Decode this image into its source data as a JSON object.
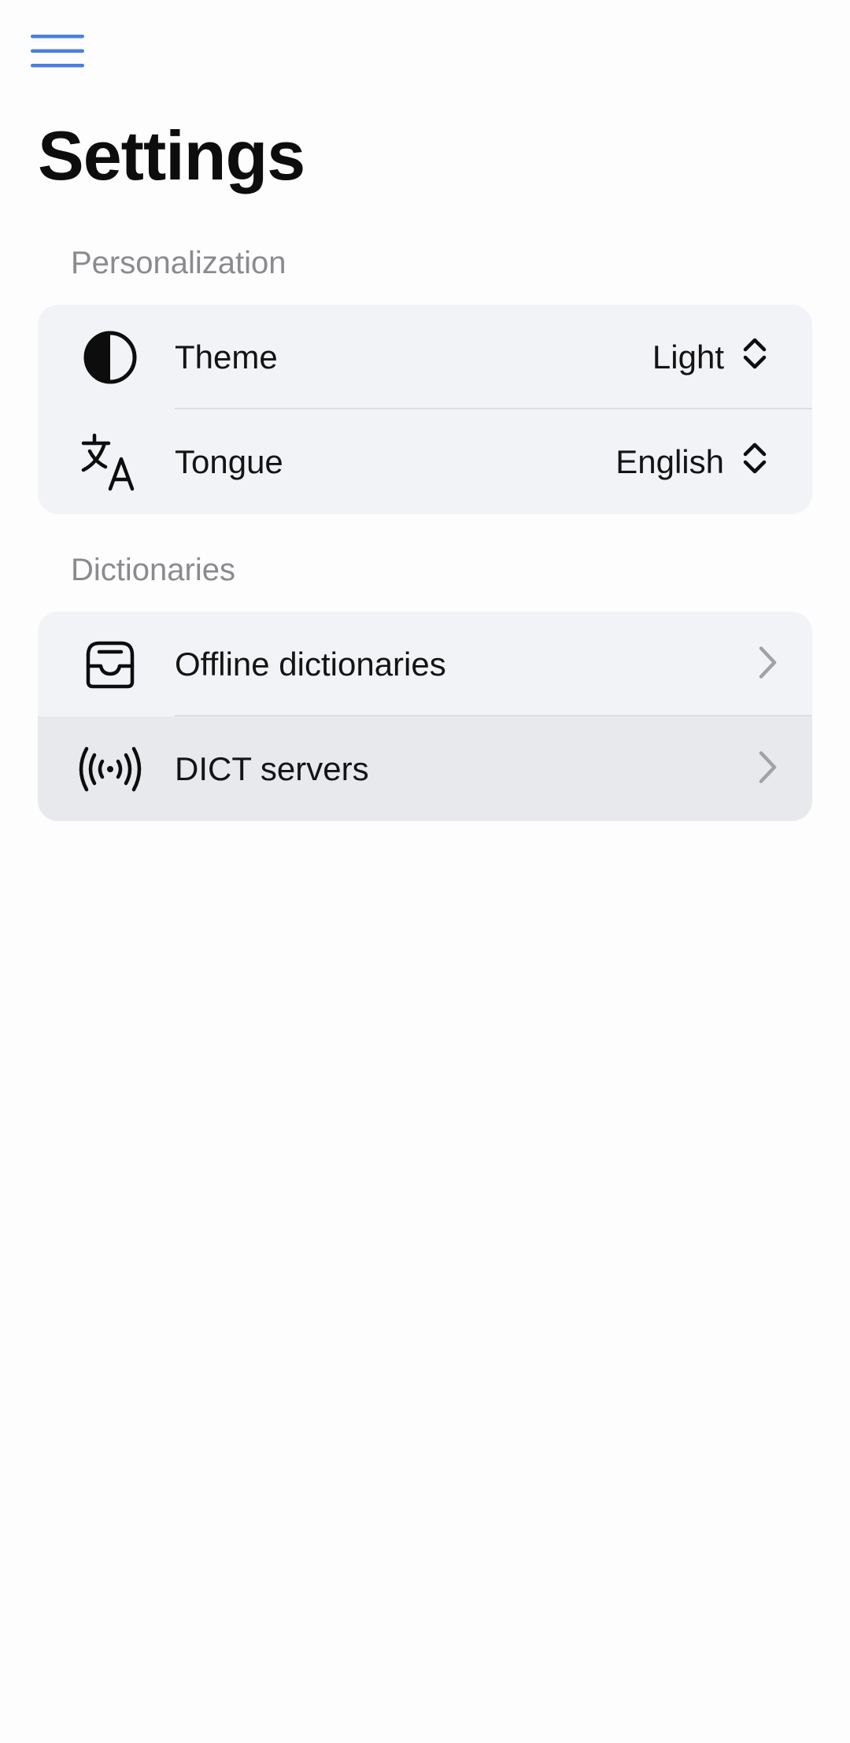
{
  "header": {
    "menu_icon": "hamburger-menu-icon",
    "title": "Settings"
  },
  "sections": [
    {
      "title": "Personalization",
      "rows": [
        {
          "icon": "half-circle-contrast-icon",
          "label": "Theme",
          "value": "Light",
          "control": "selector"
        },
        {
          "icon": "translate-icon",
          "label": "Tongue",
          "value": "English",
          "control": "selector"
        }
      ]
    },
    {
      "title": "Dictionaries",
      "rows": [
        {
          "icon": "inbox-tray-icon",
          "label": "Offline dictionaries",
          "control": "chevron"
        },
        {
          "icon": "broadcast-signal-icon",
          "label": "DICT servers",
          "control": "chevron",
          "pressed": true
        }
      ]
    }
  ],
  "colors": {
    "accent": "#4a7fe0",
    "background": "#fdfdfe",
    "group_background": "#f2f3f6",
    "pressed_row": "#e8e9ed",
    "section_header": "#8a8a8f"
  }
}
